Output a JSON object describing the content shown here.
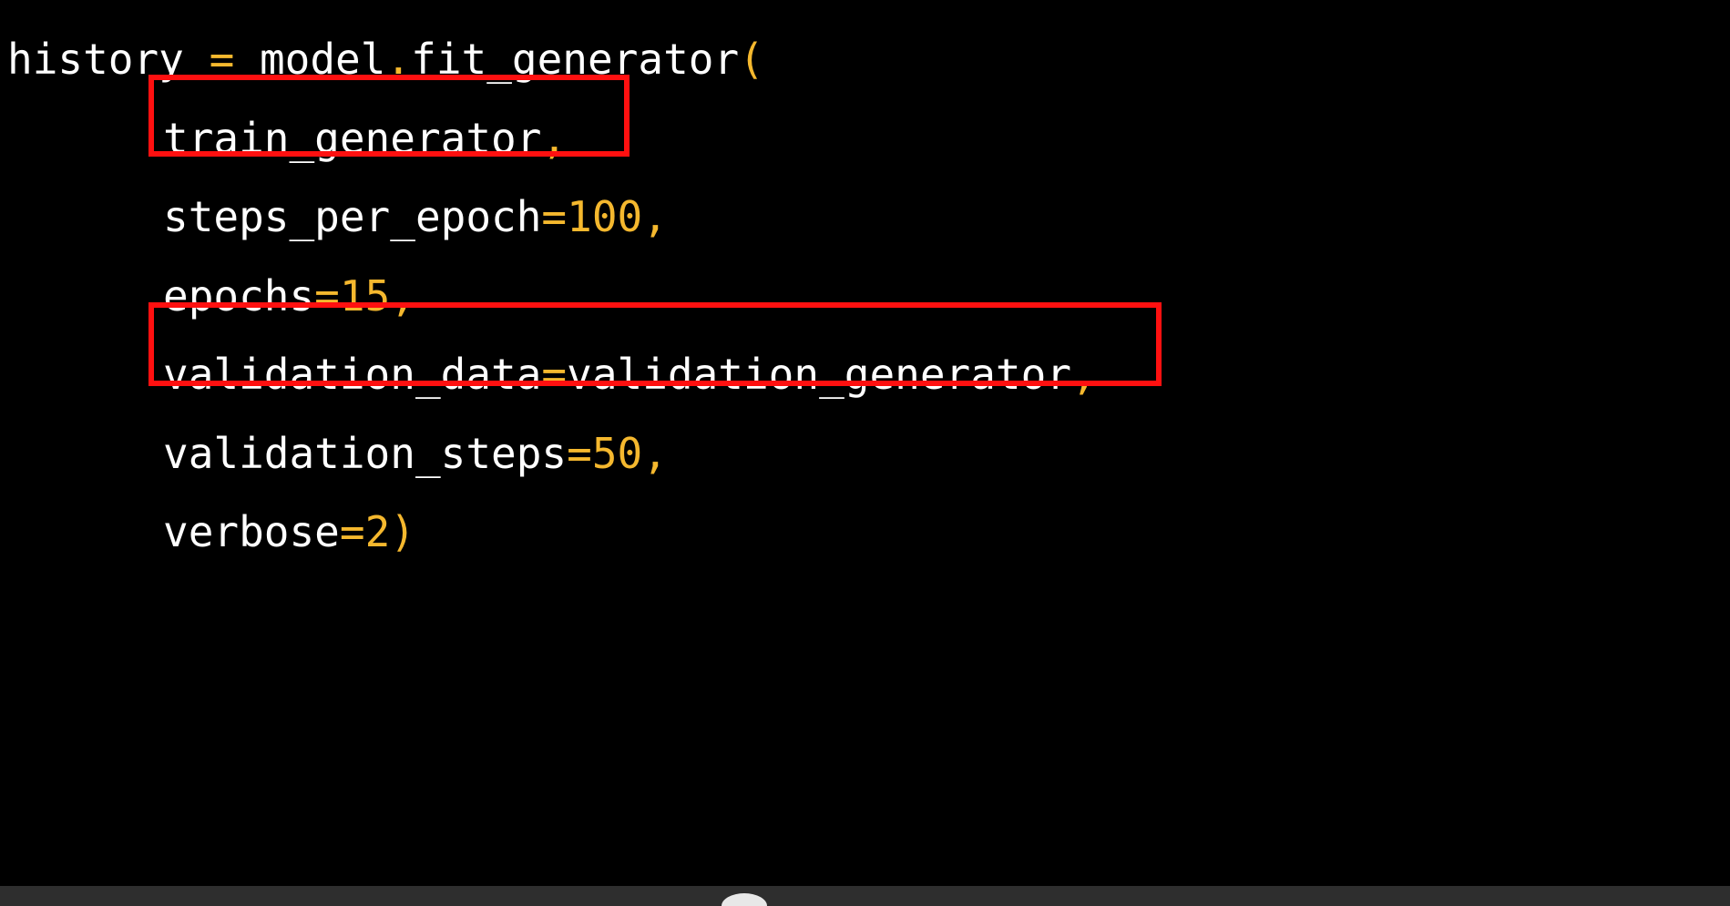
{
  "code": {
    "lines": [
      {
        "indent": false,
        "tokens": [
          {
            "text": "history ",
            "kind": "ident"
          },
          {
            "text": "=",
            "kind": "punct"
          },
          {
            "text": " model",
            "kind": "ident"
          },
          {
            "text": ".",
            "kind": "punct"
          },
          {
            "text": "fit_generator",
            "kind": "ident"
          },
          {
            "text": "(",
            "kind": "punct"
          }
        ]
      },
      {
        "indent": true,
        "tokens": [
          {
            "text": "train_generator",
            "kind": "ident"
          },
          {
            "text": ",",
            "kind": "punct"
          }
        ]
      },
      {
        "indent": true,
        "tokens": [
          {
            "text": "steps_per_epoch",
            "kind": "ident"
          },
          {
            "text": "=",
            "kind": "punct"
          },
          {
            "text": "100",
            "kind": "num"
          },
          {
            "text": ",",
            "kind": "punct"
          }
        ]
      },
      {
        "indent": true,
        "tokens": [
          {
            "text": "epochs",
            "kind": "ident"
          },
          {
            "text": "=",
            "kind": "punct"
          },
          {
            "text": "15",
            "kind": "num"
          },
          {
            "text": ",",
            "kind": "punct"
          }
        ]
      },
      {
        "indent": true,
        "tokens": [
          {
            "text": "validation_data",
            "kind": "ident"
          },
          {
            "text": "=",
            "kind": "punct"
          },
          {
            "text": "validation_generator",
            "kind": "ident"
          },
          {
            "text": ",",
            "kind": "punct"
          }
        ]
      },
      {
        "indent": true,
        "tokens": [
          {
            "text": "validation_steps",
            "kind": "ident"
          },
          {
            "text": "=",
            "kind": "punct"
          },
          {
            "text": "50",
            "kind": "num"
          },
          {
            "text": ",",
            "kind": "punct"
          }
        ]
      },
      {
        "indent": true,
        "tokens": [
          {
            "text": "verbose",
            "kind": "ident"
          },
          {
            "text": "=",
            "kind": "punct"
          },
          {
            "text": "2",
            "kind": "num"
          },
          {
            "text": ")",
            "kind": "punct"
          }
        ]
      }
    ]
  },
  "colors": {
    "background": "#000000",
    "identifier": "#ffffff",
    "operator_number": "#f5b82e",
    "highlight_box": "#ff1010",
    "bottom_bar": "#2e2e2e"
  }
}
